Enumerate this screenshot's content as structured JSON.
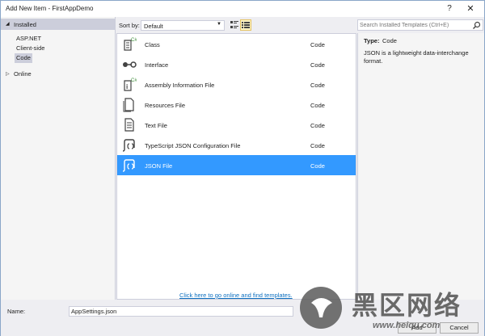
{
  "window": {
    "title": "Add New Item - FirstAppDemo",
    "help_glyph": "?",
    "close_glyph": "✕"
  },
  "tree": {
    "installed_label": "Installed",
    "items": [
      {
        "label": "ASP.NET",
        "selected": false
      },
      {
        "label": "Client-side",
        "selected": false
      },
      {
        "label": "Code",
        "selected": true
      }
    ],
    "online_label": "Online"
  },
  "toolbar": {
    "sort_label": "Sort by:",
    "sort_value": "Default"
  },
  "search": {
    "placeholder": "Search Installed Templates (Ctrl+E)"
  },
  "templates": [
    {
      "name": "Class",
      "type": "Code",
      "icon": "class-icon",
      "selected": false
    },
    {
      "name": "Interface",
      "type": "Code",
      "icon": "interface-icon",
      "selected": false
    },
    {
      "name": "Assembly Information File",
      "type": "Code",
      "icon": "assembly-info-icon",
      "selected": false
    },
    {
      "name": "Resources File",
      "type": "Code",
      "icon": "resources-file-icon",
      "selected": false
    },
    {
      "name": "Text File",
      "type": "Code",
      "icon": "text-file-icon",
      "selected": false
    },
    {
      "name": "TypeScript JSON Configuration File",
      "type": "Code",
      "icon": "json-file-icon",
      "selected": false
    },
    {
      "name": "JSON File",
      "type": "Code",
      "icon": "json-file-icon",
      "selected": true
    }
  ],
  "online_link": "Click here to go online and find templates.",
  "details": {
    "type_label": "Type:",
    "type_value": "Code",
    "description": "JSON is a lightweight data-interchange format."
  },
  "bottom": {
    "name_label": "Name:",
    "name_value": "AppSettings.json",
    "add_label": "Add",
    "cancel_label": "Cancel"
  },
  "watermark": {
    "text": "黑区网络",
    "url": "www.heiqu.com"
  },
  "colors": {
    "selection": "#3399ff",
    "accent_link": "#0e70c0",
    "tree_selected": "#cccedb"
  }
}
